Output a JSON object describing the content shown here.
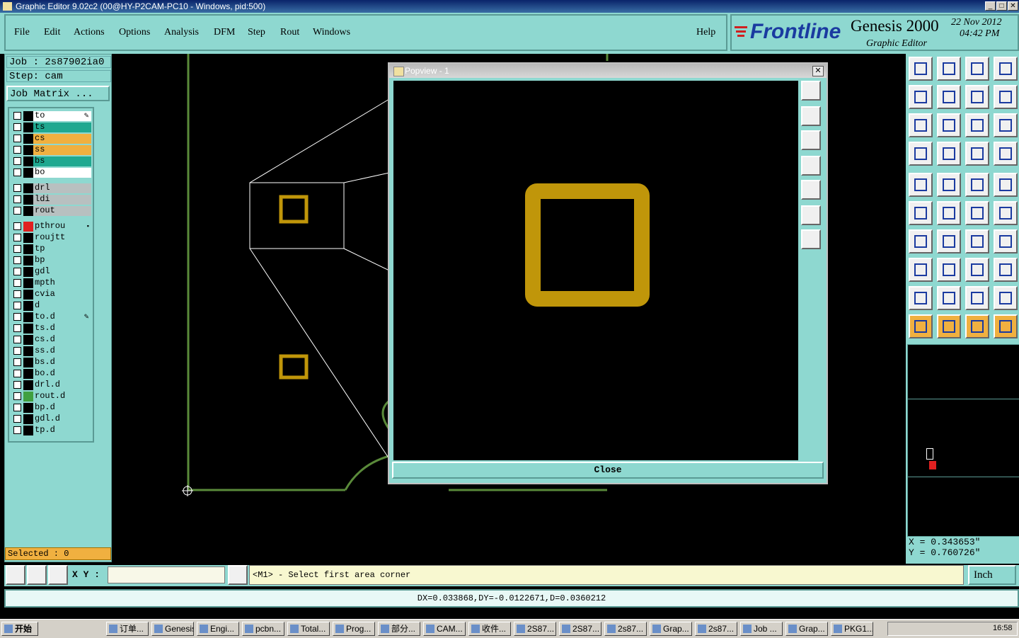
{
  "window": {
    "title": "Graphic Editor 9.02c2 (00@HY-P2CAM-PC10 - Windows, pid:500)"
  },
  "menu": [
    "File",
    "Edit",
    "Actions",
    "Options",
    "Analysis",
    "DFM",
    "Step",
    "Rout",
    "Windows"
  ],
  "help_label": "Help",
  "brand": {
    "logo": "Frontline",
    "product": "Genesis 2000",
    "subtitle": "Graphic Editor",
    "date": "22 Nov 2012",
    "time": "04:42 PM"
  },
  "job": {
    "job": "Job : 2s87902ia0",
    "step": "Step: cam",
    "matrix_button": "Job Matrix ..."
  },
  "layers": [
    {
      "name": "to",
      "color": "#ffffff",
      "mark": "✎"
    },
    {
      "name": "ts",
      "color": "#20a890",
      "mark": ""
    },
    {
      "name": "cs",
      "color": "#f0b040",
      "mark": ""
    },
    {
      "name": "ss",
      "color": "#f0b040",
      "mark": ""
    },
    {
      "name": "bs",
      "color": "#20a890",
      "mark": ""
    },
    {
      "name": "bo",
      "color": "#ffffff",
      "mark": ""
    },
    {
      "name": "drl",
      "color": "#b8c0c0",
      "mark": ""
    },
    {
      "name": "ldi",
      "color": "#b8c0c0",
      "mark": ""
    },
    {
      "name": "rout",
      "color": "#b8c0c0",
      "mark": ""
    },
    {
      "name": "pthrou",
      "color": "#8ed8d0",
      "mark": "▪"
    },
    {
      "name": "roujtt",
      "color": "#8ed8d0",
      "mark": ""
    },
    {
      "name": "tp",
      "color": "#8ed8d0",
      "mark": ""
    },
    {
      "name": "bp",
      "color": "#8ed8d0",
      "mark": ""
    },
    {
      "name": "gdl",
      "color": "#8ed8d0",
      "mark": ""
    },
    {
      "name": "mpth",
      "color": "#8ed8d0",
      "mark": ""
    },
    {
      "name": "cvia",
      "color": "#8ed8d0",
      "mark": ""
    },
    {
      "name": "d",
      "color": "#8ed8d0",
      "mark": ""
    },
    {
      "name": "to.d",
      "color": "#8ed8d0",
      "mark": "✎"
    },
    {
      "name": "ts.d",
      "color": "#8ed8d0",
      "mark": ""
    },
    {
      "name": "cs.d",
      "color": "#8ed8d0",
      "mark": ""
    },
    {
      "name": "ss.d",
      "color": "#8ed8d0",
      "mark": ""
    },
    {
      "name": "bs.d",
      "color": "#8ed8d0",
      "mark": ""
    },
    {
      "name": "bo.d",
      "color": "#8ed8d0",
      "mark": ""
    },
    {
      "name": "drl.d",
      "color": "#8ed8d0",
      "mark": ""
    },
    {
      "name": "rout.d",
      "color": "#8ed8d0",
      "mark": ""
    },
    {
      "name": "bp.d",
      "color": "#8ed8d0",
      "mark": ""
    },
    {
      "name": "gdl.d",
      "color": "#8ed8d0",
      "mark": ""
    },
    {
      "name": "tp.d",
      "color": "#8ed8d0",
      "mark": ""
    }
  ],
  "selected": "Selected : 0",
  "popup": {
    "title": "Popview - 1",
    "close_label": "Close"
  },
  "coords": {
    "x": "X = 0.343653\"",
    "y": "Y = 0.760726\""
  },
  "cmd": {
    "xy_label": "X Y :",
    "xy_value": "",
    "prompt": "<M1> - Select first area corner",
    "units": "Inch"
  },
  "status": "DX=0.033868,DY=-0.0122671,D=0.0360212",
  "taskbar": {
    "start": "开始",
    "tasks": [
      "订单...",
      "Genesis",
      "Engi...",
      "pcbn...",
      "Total...",
      "Prog...",
      "部分...",
      "CAM...",
      "收件...",
      "2S87...",
      "2S87...",
      "2s87...",
      "Grap...",
      "2s87...",
      "Job ...",
      "Grap...",
      "PKG1..."
    ],
    "clock": "16:58"
  },
  "colors": {
    "teal": "#8ed8d0",
    "pad": "#c0960a",
    "outline": "#5a8a3a"
  }
}
